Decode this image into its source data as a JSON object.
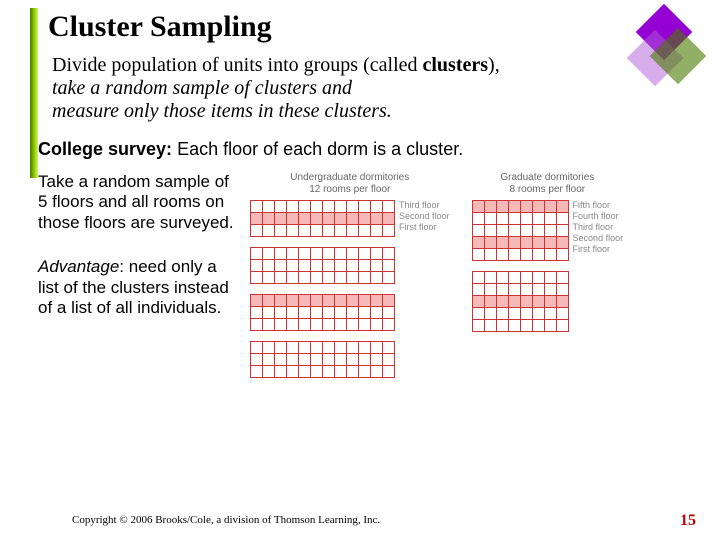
{
  "title": "Cluster Sampling",
  "body": {
    "line1a": "Divide population of units into groups (called ",
    "line1b": "clusters",
    "line1c": "),",
    "line2": "take a random sample of clusters and",
    "line3": "measure only those items in these clusters."
  },
  "subhead": {
    "lead": "College survey:",
    "rest": "  Each floor of each dorm is a cluster."
  },
  "sample_text": "Take a random sample of 5 floors and all rooms on those floors are surveyed.",
  "advantage": {
    "lead": "Advantage",
    "rest": ": need only a list of the clusters instead of a list of all individuals."
  },
  "dorms": {
    "undergrad": {
      "title_l1": "Undergraduate dormitories",
      "title_l2": "12 rooms per floor",
      "floor_labels": [
        "Third floor",
        "Second floor",
        "First floor"
      ],
      "rooms_per_floor": 12,
      "buildings": [
        {
          "floors": 3,
          "selected_rows": [
            1
          ]
        },
        {
          "floors": 3,
          "selected_rows": []
        },
        {
          "floors": 3,
          "selected_rows": [
            0
          ]
        },
        {
          "floors": 3,
          "selected_rows": []
        }
      ]
    },
    "grad": {
      "title_l1": "Graduate dormitories",
      "title_l2": "8 rooms per floor",
      "floor_labels": [
        "Fifth floor",
        "Fourth floor",
        "Third floor",
        "Second floor",
        "First floor"
      ],
      "rooms_per_floor": 8,
      "buildings": [
        {
          "floors": 5,
          "selected_rows": [
            0,
            3
          ]
        },
        {
          "floors": 5,
          "selected_rows": [
            2
          ]
        }
      ]
    }
  },
  "copyright": "Copyright © 2006 Brooks/Cole, a division of Thomson Learning, Inc.",
  "page_number": "15"
}
